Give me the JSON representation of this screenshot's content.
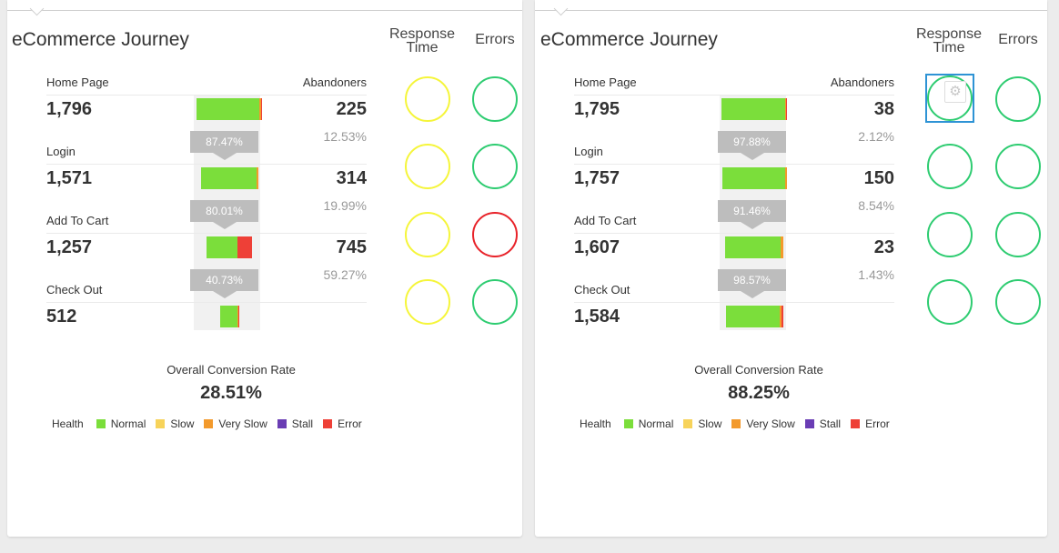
{
  "legend": {
    "title": "Health",
    "items": [
      {
        "label": "Normal",
        "color": "#7bde3b"
      },
      {
        "label": "Slow",
        "color": "#f7d35a"
      },
      {
        "label": "Very Slow",
        "color": "#f39a2c"
      },
      {
        "label": "Stall",
        "color": "#6a3db4"
      },
      {
        "label": "Error",
        "color": "#ee4037"
      }
    ]
  },
  "panels": [
    {
      "title": "eCommerce Journey",
      "response_time_header": "Response Time",
      "errors_header": "Errors",
      "abandoners_header": "Abandoners",
      "steps": [
        {
          "name": "Home Page",
          "count": "1,796",
          "abandoners": "225",
          "health": {
            "normal": 0.96,
            "very_slow": 0.02,
            "error": 0.02
          },
          "bar_fraction": 1.0,
          "response_time_status": "yellow",
          "errors_status": "green"
        },
        {
          "name": "Login",
          "count": "1,571",
          "abandoners": "314",
          "health": {
            "normal": 0.97,
            "very_slow": 0.03
          },
          "bar_fraction": 0.875,
          "response_time_status": "yellow",
          "errors_status": "green"
        },
        {
          "name": "Add To Cart",
          "count": "1,257",
          "abandoners": "745",
          "health": {
            "normal": 0.68,
            "error": 0.32
          },
          "bar_fraction": 0.7,
          "response_time_status": "yellow",
          "errors_status": "red"
        },
        {
          "name": "Check Out",
          "count": "512",
          "abandoners": "",
          "health": {
            "normal": 0.9,
            "very_slow": 0.05,
            "error": 0.05
          },
          "bar_fraction": 0.285,
          "response_time_status": "yellow",
          "errors_status": "green"
        }
      ],
      "step_conversions": [
        "87.47%",
        "80.01%",
        "40.73%"
      ],
      "abandon_pcts": [
        "12.53%",
        "19.99%",
        "59.27%"
      ],
      "overall_label": "Overall Conversion Rate",
      "overall_value": "28.51%"
    },
    {
      "title": "eCommerce Journey",
      "response_time_header": "Response Time",
      "errors_header": "Errors",
      "abandoners_header": "Abandoners",
      "steps": [
        {
          "name": "Home Page",
          "count": "1,795",
          "abandoners": "38",
          "health": {
            "normal": 0.97,
            "very_slow": 0.015,
            "error": 0.015
          },
          "bar_fraction": 1.0,
          "response_time_status": "green",
          "response_time_selected": true,
          "errors_status": "green"
        },
        {
          "name": "Login",
          "count": "1,757",
          "abandoners": "150",
          "health": {
            "normal": 0.97,
            "very_slow": 0.03
          },
          "bar_fraction": 0.98,
          "response_time_status": "green",
          "errors_status": "green"
        },
        {
          "name": "Add To Cart",
          "count": "1,607",
          "abandoners": "23",
          "health": {
            "normal": 0.96,
            "very_slow": 0.04
          },
          "bar_fraction": 0.895,
          "response_time_status": "green",
          "errors_status": "green"
        },
        {
          "name": "Check Out",
          "count": "1,584",
          "abandoners": "",
          "health": {
            "normal": 0.93,
            "very_slow": 0.04,
            "error": 0.03
          },
          "bar_fraction": 0.88,
          "response_time_status": "green",
          "errors_status": "green"
        }
      ],
      "step_conversions": [
        "97.88%",
        "91.46%",
        "98.57%"
      ],
      "abandon_pcts": [
        "2.12%",
        "8.54%",
        "1.43%"
      ],
      "overall_label": "Overall Conversion Rate",
      "overall_value": "88.25%",
      "gear_icon": "gear-icon"
    }
  ]
}
